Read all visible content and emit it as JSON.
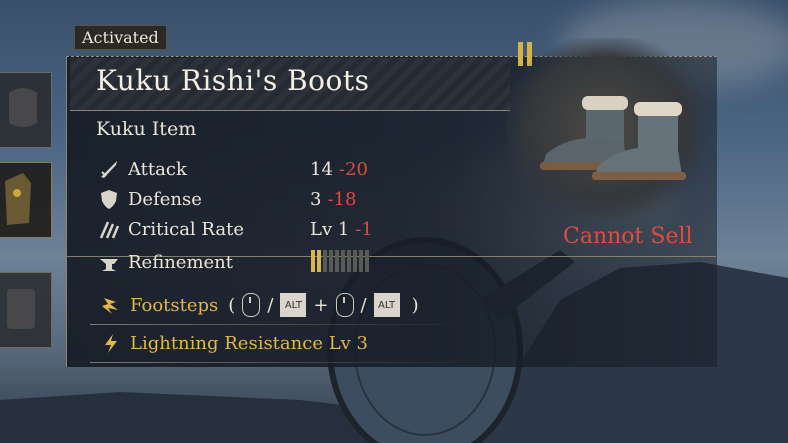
{
  "status_badge": "Activated",
  "item": {
    "name": "Kuku Rishi's Boots",
    "category": "Kuku Item",
    "sell_status": "Cannot Sell"
  },
  "stats": [
    {
      "label": "Attack",
      "value": "14",
      "delta": "-20",
      "icon": "sword-icon"
    },
    {
      "label": "Defense",
      "value": "3",
      "delta": "-18",
      "icon": "shield-icon"
    },
    {
      "label": "Critical Rate",
      "value": "Lv 1",
      "delta": "-1",
      "icon": "critical-claw-icon"
    },
    {
      "label": "Refinement",
      "value": "",
      "delta": "",
      "icon": "anvil-icon"
    }
  ],
  "refinement": {
    "filled": 2,
    "total": 10
  },
  "effects": {
    "footsteps": {
      "label": "Footsteps",
      "open_paren": "(",
      "close_paren": ")",
      "key1": "ALT",
      "key2": "ALT",
      "slash": "/",
      "plus": "+"
    },
    "lightning": {
      "label": "Lightning Resistance Lv 3"
    }
  },
  "colors": {
    "accent_gold": "#e2b648",
    "negative_red": "#e0483c",
    "text": "#ede6d6"
  }
}
